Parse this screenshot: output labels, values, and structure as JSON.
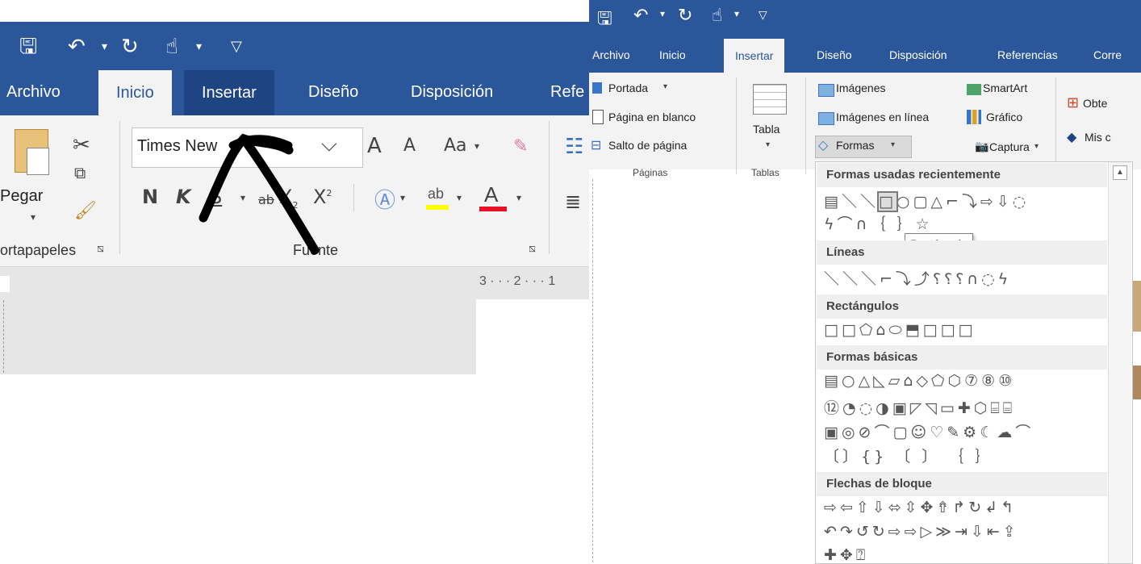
{
  "left": {
    "tabs": [
      "Archivo",
      "Inicio",
      "Insertar",
      "Diseño",
      "Disposición",
      "Refe"
    ],
    "clipboard": {
      "paste_label": "Pegar",
      "group_label": "ortapapeles"
    },
    "font": {
      "font_name": "Times New",
      "grow": "A",
      "shrink": "A",
      "case": "Aa",
      "bold": "N",
      "italic": "K",
      "underline": "S",
      "strike": "ab",
      "sub": "X",
      "sup": "X",
      "group_label": "Fuente"
    },
    "ruler_text": "3 · · · 2 · · · 1"
  },
  "right": {
    "tabs": [
      "Archivo",
      "Inicio",
      "Insertar",
      "Diseño",
      "Disposición",
      "Referencias",
      "Corre"
    ],
    "paginas": {
      "portada": "Portada",
      "blanco": "Página en blanco",
      "salto": "Salto de página",
      "group_label": "Páginas"
    },
    "tablas": {
      "tabla": "Tabla",
      "group_label": "Tablas"
    },
    "ilustraciones": {
      "imagenes": "Imágenes",
      "imagenes_linea": "Imágenes en línea",
      "formas": "Formas",
      "smartart": "SmartArt",
      "grafico": "Gráfico",
      "captura": "Captura"
    },
    "complementos": {
      "obtener": "Obte",
      "mis": "Mis c"
    },
    "shapes_panel": {
      "sections": [
        "Formas usadas recientemente",
        "Líneas",
        "Rectángulos",
        "Formas básicas",
        "Flechas de bloque"
      ],
      "tooltip": "Rectángulo"
    }
  },
  "icons": [
    "save-icon",
    "undo-icon",
    "redo-icon",
    "touch-mode-icon",
    "customize-icon",
    "paste-icon",
    "cut-icon",
    "copy-icon",
    "format-painter-icon",
    "eraser-icon",
    "text-effects-icon",
    "highlight-icon",
    "font-color-icon",
    "bullets-icon",
    "table-icon",
    "pictures-icon",
    "smartart-icon",
    "chart-icon",
    "shapes-icon",
    "screenshot-icon",
    "addins-icon"
  ],
  "colors": {
    "ribbon_blue": "#2b579a",
    "ribbon_bg": "#f3f3f3",
    "highlight_yellow": "#ffff00",
    "font_red": "#e81123"
  }
}
